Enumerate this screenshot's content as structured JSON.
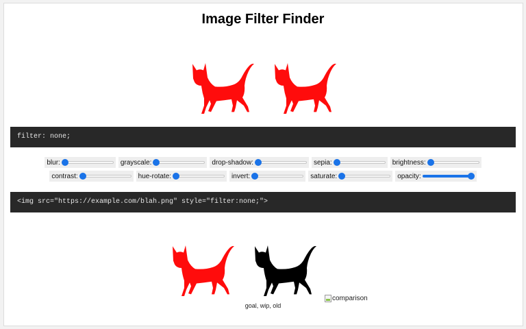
{
  "page": {
    "title": "Image Filter Finder",
    "css_output": "filter: none;",
    "html_output": "<img src=\"https://example.com/blah.png\" style=\"filter:none;\">",
    "caption": "goal, wip, old",
    "broken_image_alt": "comparison"
  },
  "colors": {
    "cat_red": "#ff0c0c",
    "cat_black": "#000000",
    "code_bg": "#282828",
    "accent": "#1a73e8"
  },
  "sliders": {
    "row1": [
      {
        "label": "blur:",
        "value": 0
      },
      {
        "label": "grayscale:",
        "value": 0
      },
      {
        "label": "drop-shadow:",
        "value": 0
      },
      {
        "label": "sepia:",
        "value": 0
      },
      {
        "label": "brightness:",
        "value": 0
      }
    ],
    "row2": [
      {
        "label": "contrast:",
        "value": 0
      },
      {
        "label": "hue-rotate:",
        "value": 0
      },
      {
        "label": "invert:",
        "value": 0
      },
      {
        "label": "saturate:",
        "value": 0
      },
      {
        "label": "opacity:",
        "value": 1
      }
    ]
  },
  "icons": {
    "cat": "cat-silhouette-icon",
    "broken_image": "broken-image-icon"
  }
}
